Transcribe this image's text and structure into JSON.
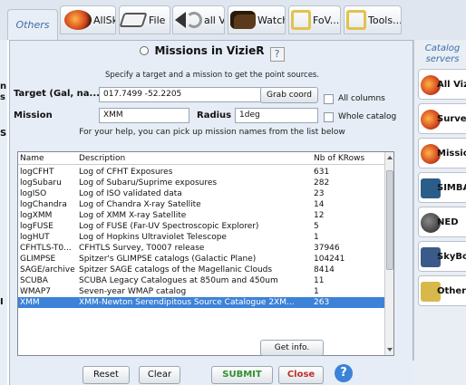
{
  "toolbar": {
    "tabs": [
      "Others",
      "AllSky",
      "File",
      "all VO",
      "Watch",
      "FoV...",
      "Tools..."
    ]
  },
  "left_cut": [
    "n",
    "s",
    "S",
    "I"
  ],
  "right_panel": {
    "label": "Catalog servers",
    "buttons": [
      "All VizieR",
      "Surveys",
      "Missions",
      "SIMBAD",
      "NED",
      "SkyBot",
      "Others.."
    ]
  },
  "dialog": {
    "title": "Missions in VizieR",
    "help": "?",
    "subtitle": "Specify a target and a mission to get the point sources.",
    "target_label": "Target (Gal, na...",
    "target_value": "017.7499 -52.2205",
    "grab_label": "Grab coord",
    "all_columns_label": "All columns",
    "whole_catalog_label": "Whole catalog",
    "mission_label": "Mission",
    "mission_value": "XMM",
    "radius_label": "Radius",
    "radius_value": "1deg",
    "hint": "For your help, you can pick up mission names from the list below",
    "columns": [
      "Name",
      "Description",
      "Nb of KRows"
    ],
    "rows": [
      {
        "name": "logCFHT",
        "desc": "Log of CFHT Exposures",
        "n": "631"
      },
      {
        "name": "logSubaru",
        "desc": "Log of Subaru/Suprime exposures",
        "n": "282"
      },
      {
        "name": "logISO",
        "desc": "Log of ISO validated data",
        "n": "23"
      },
      {
        "name": "logChandra",
        "desc": "Log of Chandra X-ray Satellite",
        "n": "14"
      },
      {
        "name": "logXMM",
        "desc": "Log of XMM X-ray Satellite",
        "n": "12"
      },
      {
        "name": "logFUSE",
        "desc": "Log of FUSE (Far-UV Spectroscopic Explorer)",
        "n": "5"
      },
      {
        "name": "logHUT",
        "desc": "Log of Hopkins Ultraviolet Telescope",
        "n": "1"
      },
      {
        "name": "CFHTLS-T0...",
        "desc": "CFHTLS Survey, T0007 release",
        "n": "37946"
      },
      {
        "name": "GLIMPSE",
        "desc": "Spitzer's GLIMPSE catalogs (Galactic Plane)",
        "n": "104241"
      },
      {
        "name": "SAGE/archive",
        "desc": "Spitzer SAGE catalogs of the Magellanic Clouds",
        "n": "8414"
      },
      {
        "name": "SCUBA",
        "desc": "SCUBA Legacy Catalogues at 850um and 450um",
        "n": "11"
      },
      {
        "name": "WMAP7",
        "desc": "Seven-year WMAP catalog",
        "n": "1"
      },
      {
        "name": "XMM",
        "desc": "XMM-Newton Serendipitous Source Catalogue 2XM...",
        "n": "263"
      }
    ],
    "get_info_label": "Get info.",
    "reset_label": "Reset",
    "clear_label": "Clear",
    "submit_label": "SUBMIT",
    "close_label": "Close",
    "help_circle": "?"
  }
}
